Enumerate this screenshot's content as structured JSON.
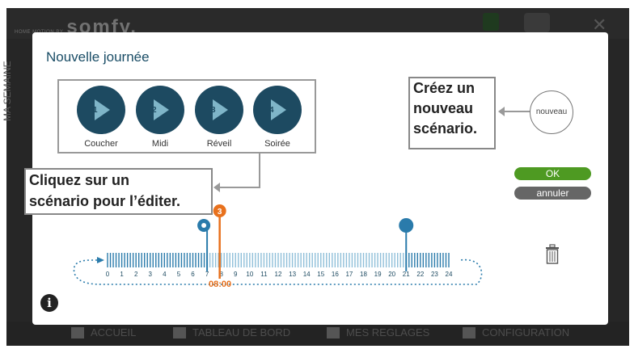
{
  "app": {
    "brand_small": "HOME MOTION BY",
    "brand_logo": "somfy.",
    "side_label": "MA SEMAINE",
    "nav": [
      "ACCUEIL",
      "TABLEAU DE BORD",
      "MES REGLAGES",
      "CONFIGURATION"
    ]
  },
  "modal": {
    "title": "Nouvelle journée",
    "scenarios": [
      {
        "number": "1",
        "label": "Coucher"
      },
      {
        "number": "2",
        "label": "Midi"
      },
      {
        "number": "3",
        "label": "Réveil"
      },
      {
        "number": "4",
        "label": "Soirée"
      }
    ],
    "callout_new": [
      "Créez un",
      "nouveau",
      "scénario."
    ],
    "callout_edit": [
      "Cliquez sur un",
      "scénario pour l’éditer."
    ],
    "new_button": "nouveau",
    "ok_button": "OK",
    "cancel_button": "annuler",
    "info_icon": "info-icon",
    "trash_icon": "trash-icon"
  },
  "timeline": {
    "hours": [
      "0",
      "1",
      "2",
      "3",
      "4",
      "5",
      "6",
      "7",
      "8",
      "9",
      "10",
      "11",
      "12",
      "13",
      "14",
      "15",
      "16",
      "17",
      "18",
      "19",
      "20",
      "21",
      "22",
      "23",
      "24"
    ],
    "current_marker": "3",
    "current_time": "08:00",
    "sun_marker_hour": 7,
    "cursor_hour": 8,
    "moon_marker_hour": 21,
    "colors": {
      "bar": "#2a7bab",
      "cursor": "#e8711d",
      "ok": "#4e9a22",
      "primary": "#1d4a61"
    }
  }
}
